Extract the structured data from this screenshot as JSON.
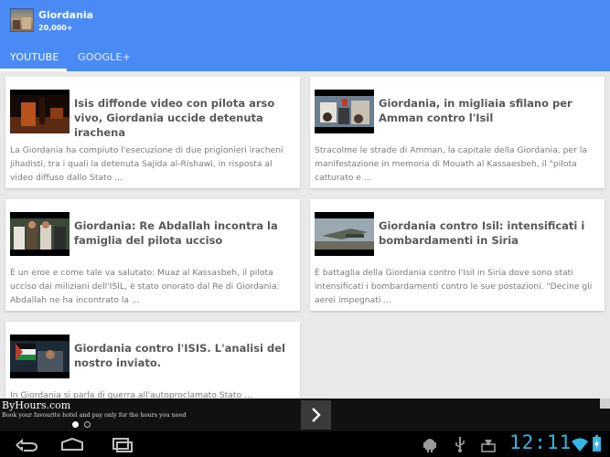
{
  "app_bar": {
    "title": "Giordania",
    "count": "20,000+",
    "accent_color": "#4a8af4"
  },
  "tabs": [
    {
      "label": "YOUTUBE",
      "active": true
    },
    {
      "label": "GOOGLE+",
      "active": false
    }
  ],
  "cards": [
    {
      "title": "Isis diffonde video con pilota arso vivo, Giordania uccide detenuta irachena",
      "description": "La Giordania ha compiuto l'esecuzione di due prigionieri iracheni jihadisti, tra i quali la detenuta Sajida al-Rishawi, in risposta al video diffuso dallo Stato ..."
    },
    {
      "title": "Giordania, in migliaia sfilano per Amman contro l'Isil",
      "description": "Stracolme le strade di Amman, la capitale della Giordania, per la manifestazione in memoria di Mouath al Kassaesbeh, il \"pilota catturato e ..."
    },
    {
      "title": "Giordania: Re Abdallah incontra la famiglia del pilota ucciso",
      "description": "È un eroe e come tale va salutato: Muaz al Kassasbeh, il pilota ucciso dai miliziani dell'ISIL, è stato onorato dal Re di Giordania: Abdallah ne ha incontrato la ..."
    },
    {
      "title": "Giordania contro Isil: intensificati i bombardamenti in Siria",
      "description": "È battaglia della Giordania contro l'Isil in Siria dove sono stati intensificati i bombardamenti contro le sue postazioni. \"Decine gli aerei impegnati ..."
    },
    {
      "title": "Giordania contro l'ISIS. L'analisi del nostro inviato.",
      "description": "In Giordania si parla di guerra all'autoproclamato Stato ..."
    }
  ],
  "ad": {
    "title": "ByHours.com",
    "subtitle": "Book your favourite hotel and pay only for the hours you need"
  },
  "system_bar": {
    "clock": "12:11",
    "clock_color": "#33b5e5",
    "icons": [
      "back-icon",
      "home-icon",
      "recent-apps-icon",
      "android-debug-icon",
      "usb-icon",
      "download-icon",
      "wifi-icon",
      "battery-icon"
    ]
  }
}
